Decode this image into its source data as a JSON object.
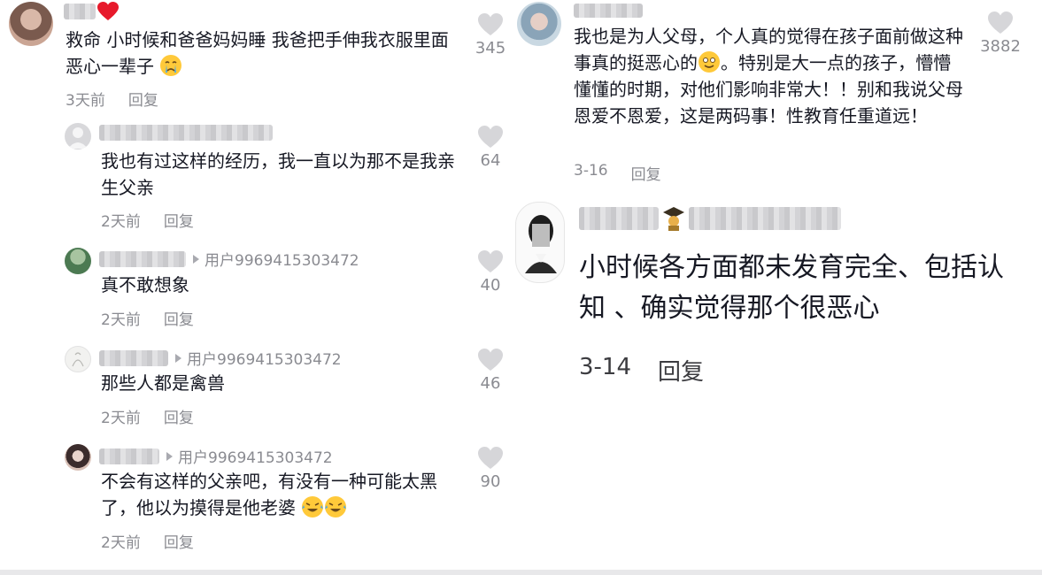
{
  "left": {
    "top_comment": {
      "text": "救命 小时候和爸爸妈妈睡 我爸把手伸我衣服里面 恶心一辈子",
      "time": "3天前",
      "reply": "回复",
      "likes": "345"
    },
    "replies": [
      {
        "reply_to": "",
        "text": "我也有过这样的经历，我一直以为那不是我亲生父亲",
        "time": "2天前",
        "reply": "回复",
        "likes": "64"
      },
      {
        "reply_to": "用户9969415303472",
        "text": "真不敢想象",
        "time": "2天前",
        "reply": "回复",
        "likes": "40"
      },
      {
        "reply_to": "用户9969415303472",
        "text": "那些人都是禽兽",
        "time": "2天前",
        "reply": "回复",
        "likes": "46"
      },
      {
        "reply_to": "用户9969415303472",
        "text": "不会有这样的父亲吧，有没有一种可能太黑了，他以为摸得是他老婆",
        "time": "2天前",
        "reply": "回复",
        "likes": "90"
      }
    ]
  },
  "right": {
    "top_comment": {
      "text": "我也是为人父母，个人真的觉得在孩子面前做这种事真的挺恶心的",
      "text2": "。特别是大一点的孩子，懵懵懂懂的时期，对他们影响非常大！！别和我说父母恩爱不恩爱，这是两码事！性教育任重道远！",
      "time": "3-16",
      "reply": "回复",
      "likes": "3882"
    },
    "second_comment": {
      "text": "小时候各方面都未发育完全、包括认知 、确实觉得那个很恶心",
      "time": "3-14",
      "reply": "回复"
    }
  },
  "icons": {
    "like": "heart-outline-icon",
    "reply_arrow": "triangle-right-icon"
  },
  "colors": {
    "text": "#161823",
    "meta": "#8a8b91",
    "heart": "#d6d6d9"
  }
}
